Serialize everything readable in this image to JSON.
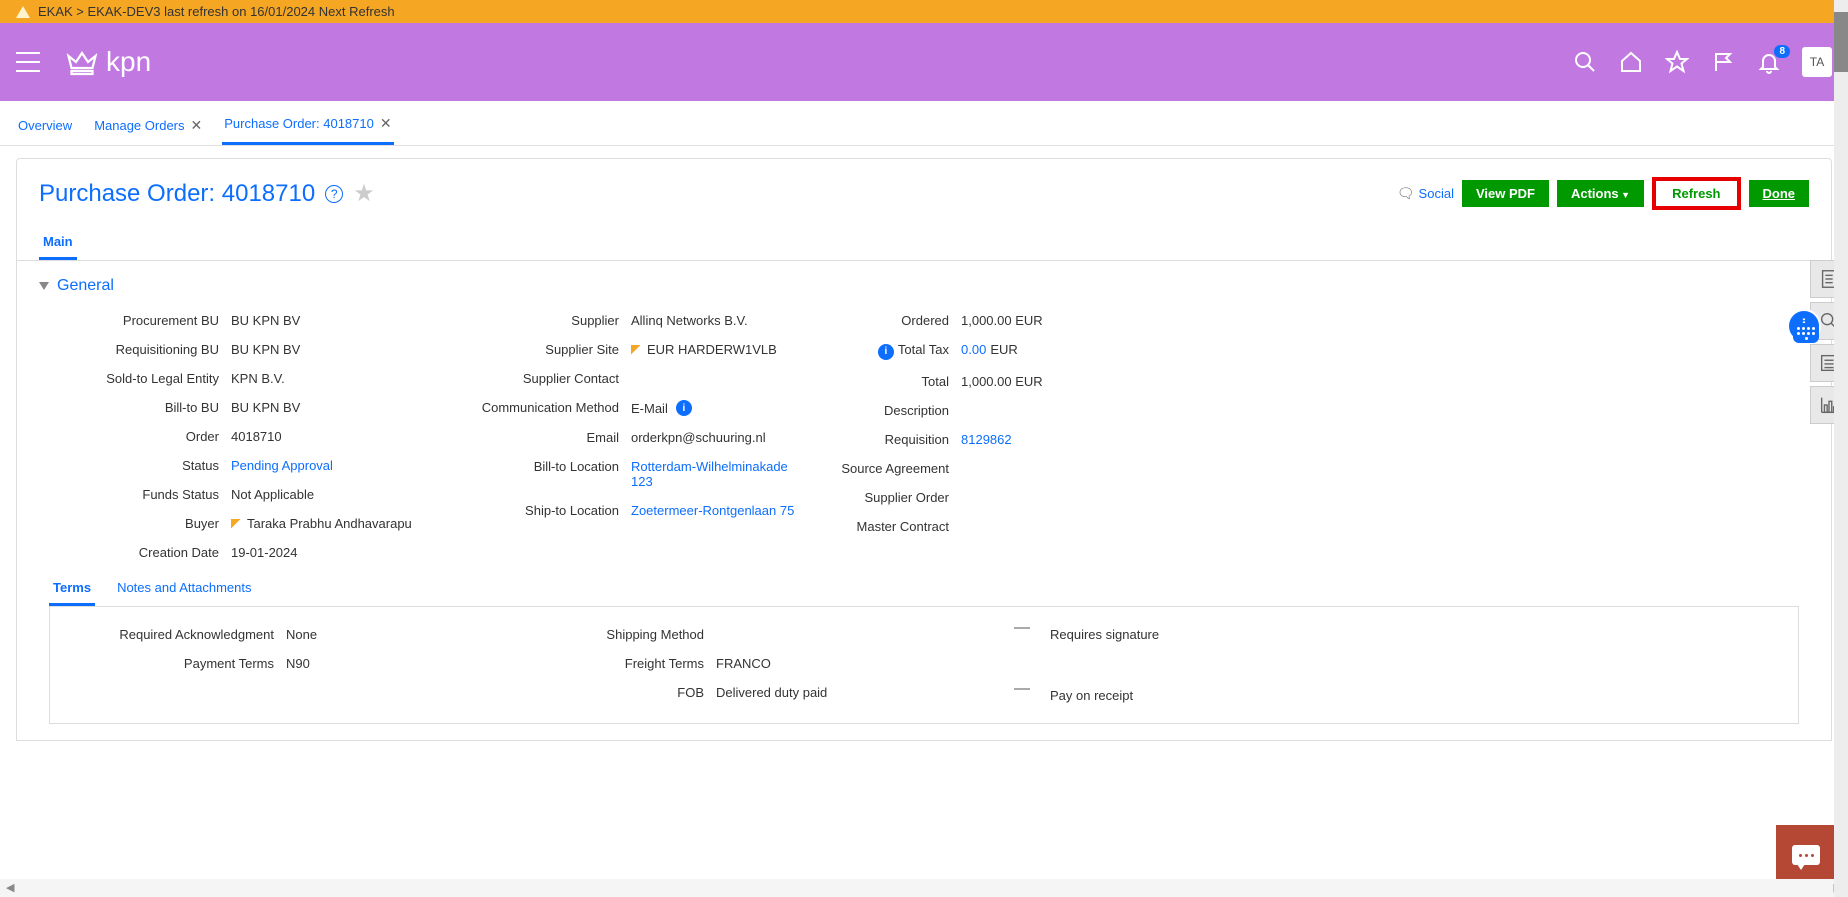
{
  "notification": {
    "text": "EKAK > EKAK-DEV3 last refresh on 16/01/2024 Next Refresh"
  },
  "header": {
    "logo_text": "kpn",
    "avatar": "TA",
    "badge_count": "8"
  },
  "tabs": {
    "overview": "Overview",
    "manage_orders": "Manage Orders",
    "po": "Purchase Order: 4018710"
  },
  "page": {
    "title": "Purchase Order: 4018710",
    "social": "Social",
    "view_pdf": "View PDF",
    "actions": "Actions",
    "refresh": "Refresh",
    "done": "Done"
  },
  "sub_tabs": {
    "main": "Main"
  },
  "section": {
    "general": "General"
  },
  "general": {
    "proc_bu_l": "Procurement BU",
    "proc_bu_v": "BU KPN BV",
    "req_bu_l": "Requisitioning BU",
    "req_bu_v": "BU KPN BV",
    "sold_to_l": "Sold-to Legal Entity",
    "sold_to_v": "KPN B.V.",
    "bill_to_bu_l": "Bill-to BU",
    "bill_to_bu_v": "BU KPN BV",
    "order_l": "Order",
    "order_v": "4018710",
    "status_l": "Status",
    "status_v": "Pending Approval",
    "funds_l": "Funds Status",
    "funds_v": "Not Applicable",
    "buyer_l": "Buyer",
    "buyer_v": "Taraka Prabhu Andhavarapu",
    "creation_l": "Creation Date",
    "creation_v": "19-01-2024",
    "supplier_l": "Supplier",
    "supplier_v": "Allinq Networks B.V.",
    "site_l": "Supplier Site",
    "site_v": "EUR HARDERW1VLB",
    "contact_l": "Supplier Contact",
    "contact_v": "",
    "comm_l": "Communication Method",
    "comm_v": "E-Mail",
    "email_l": "Email",
    "email_v": "orderkpn@schuuring.nl",
    "bill_loc_l": "Bill-to Location",
    "bill_loc_v": "Rotterdam-Wilhelminakade 123",
    "ship_loc_l": "Ship-to Location",
    "ship_loc_v": "Zoetermeer-Rontgenlaan 75",
    "ordered_l": "Ordered",
    "ordered_v": "1,000.00  EUR",
    "tax_l": "Total Tax",
    "tax_v": "0.00",
    "tax_cur": " EUR",
    "total_l": "Total",
    "total_v": "1,000.00  EUR",
    "desc_l": "Description",
    "desc_v": "",
    "requisition_l": "Requisition",
    "requisition_v": "8129862",
    "src_agr_l": "Source Agreement",
    "src_agr_v": "",
    "sup_order_l": "Supplier Order",
    "sup_order_v": "",
    "master_l": "Master Contract",
    "master_v": ""
  },
  "terms_tabs": {
    "terms": "Terms",
    "notes": "Notes and Attachments"
  },
  "terms": {
    "ack_l": "Required Acknowledgment",
    "ack_v": "None",
    "pay_l": "Payment Terms",
    "pay_v": "N90",
    "ship_m_l": "Shipping Method",
    "ship_m_v": "",
    "freight_l": "Freight Terms",
    "freight_v": "FRANCO",
    "fob_l": "FOB",
    "fob_v": "Delivered duty paid",
    "sig_l": "Requires signature",
    "por_l": "Pay on receipt"
  }
}
